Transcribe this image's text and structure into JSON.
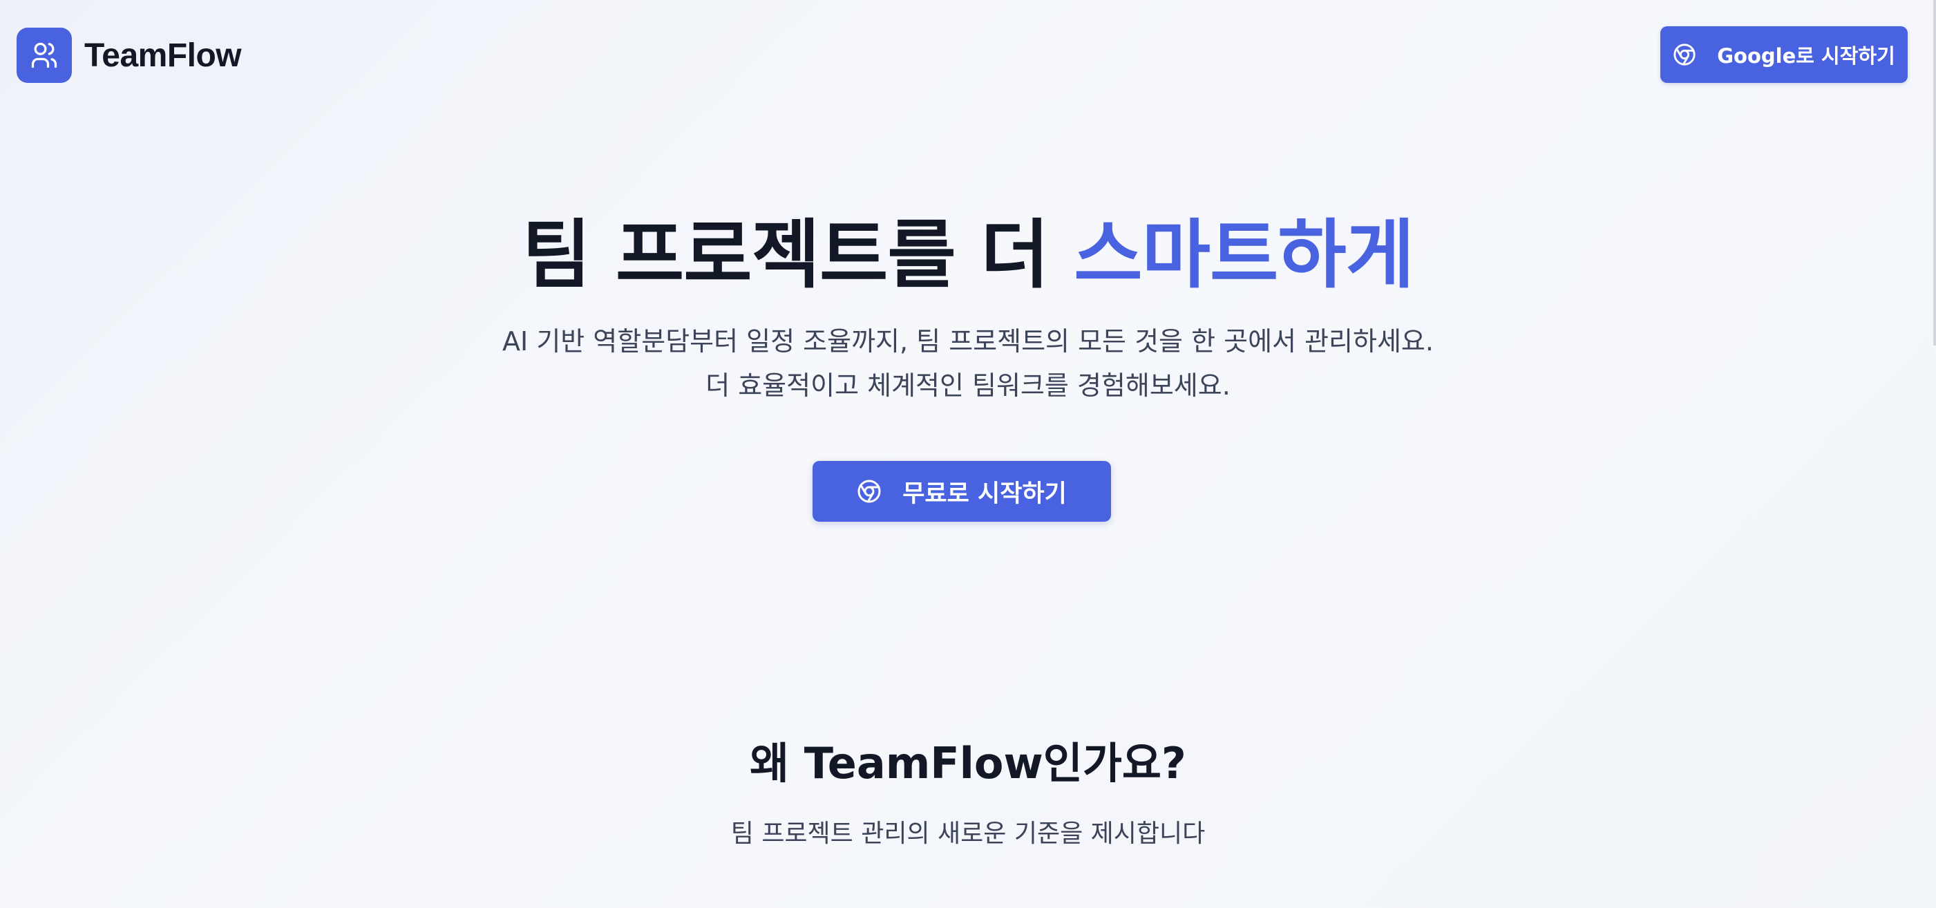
{
  "header": {
    "brand": "TeamFlow",
    "logo_icon": "users-icon",
    "google_button_label": "Google로 시작하기",
    "google_button_icon": "chrome-icon"
  },
  "hero": {
    "title_main": "팀 프로젝트를 더 ",
    "title_accent": "스마트하게",
    "subtitle_line1": "AI 기반 역할분담부터 일정 조율까지, 팀 프로젝트의 모든 것을 한 곳에서 관리하세요.",
    "subtitle_line2": "더 효율적이고 체계적인 팀워크를 경험해보세요.",
    "cta_label": "무료로 시작하기",
    "cta_icon": "chrome-icon"
  },
  "why": {
    "title": "왜 TeamFlow인가요?",
    "subtitle": "팀 프로젝트 관리의 새로운 기준을 제시합니다"
  },
  "colors": {
    "accent": "#4963e0",
    "text_dark": "#121826",
    "text_muted": "#3b4458",
    "background": "#f3f6fb"
  }
}
